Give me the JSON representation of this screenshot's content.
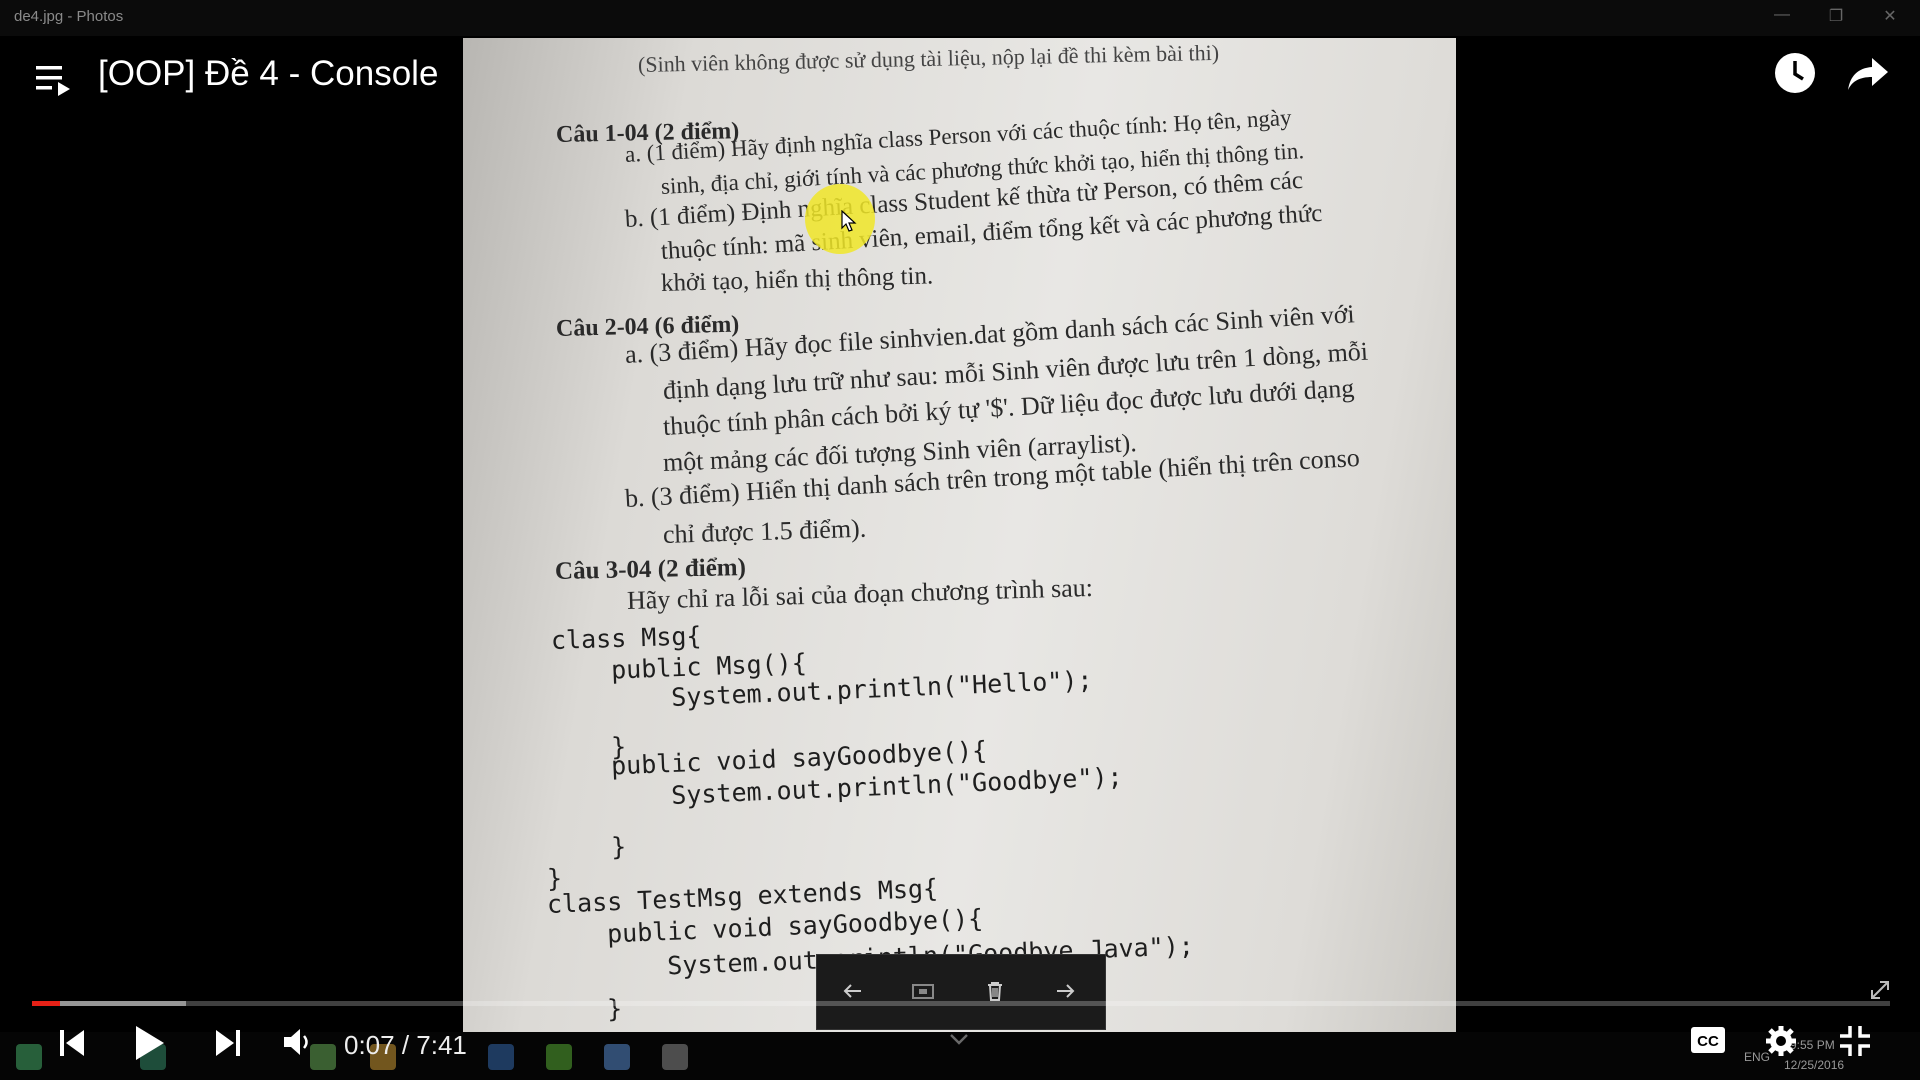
{
  "window": {
    "title": "de4.jpg - Photos",
    "controls": [
      "—",
      "❐",
      "✕"
    ]
  },
  "video": {
    "title": "[OOP] Đề 4 - Console",
    "current_time": "0:07",
    "duration": "7:41",
    "time_display": "0:07 / 7:41",
    "progress_fraction": 0.015,
    "buffered_fraction": 0.083,
    "accent_color": "#e62117"
  },
  "document": {
    "header_note": "(Sinh viên không được sử dụng tài liệu, nộp lại đề thi kèm bài thi)",
    "q1_title": "Câu 1-04 (2 điểm)",
    "q1a_line1": "a. (1 điểm) Hãy định nghĩa class Person với các thuộc tính: Họ tên, ngày",
    "q1a_line2": "sinh, địa chỉ, giới tính và các phương thức khởi tạo, hiển thị thông tin.",
    "q1b_line1": "b. (1 điểm) Định nghĩa class Student kế thừa từ Person, có thêm các",
    "q1b_line2": "thuộc tính: mã sinh viên, email, điểm tổng kết và các phương thức",
    "q1b_line3": "khởi tạo, hiển thị thông tin.",
    "q2_title": "Câu 2-04 (6 điểm)",
    "q2a_line1": "a. (3 điểm) Hãy đọc file sinhvien.dat gồm danh sách các Sinh viên với",
    "q2a_line2": "định dạng lưu trữ như sau: mỗi Sinh viên được lưu trên 1 dòng, mỗi",
    "q2a_line3": "thuộc tính phân cách bởi ký tự '$'. Dữ liệu đọc được lưu dưới dạng",
    "q2a_line4": "một mảng các đối tượng Sinh viên (arraylist).",
    "q2b_line1": "b. (3 điểm) Hiển thị danh sách trên trong một table (hiển thị trên conso",
    "q2b_line2": "chỉ được 1.5 điểm).",
    "q3_title": "Câu 3-04 (2 điểm)",
    "q3_intro": "Hãy chỉ ra lỗi sai của đoạn chương trình sau:",
    "code": [
      "class Msg{",
      "    public Msg(){",
      "        System.out.println(\"Hello\");",
      "    }",
      "    public void sayGoodbye(){",
      "        System.out.println(\"Goodbye\");",
      "    }",
      "}",
      "class TestMsg extends Msg{",
      "    public void sayGoodbye(){",
      "        System.out.println(\"Goodbye Java\");",
      "    }"
    ]
  },
  "photo_nav": {
    "prev_icon": "arrow-left-icon",
    "slideshow_icon": "slideshow-icon",
    "delete_icon": "trash-icon",
    "next_icon": "arrow-right-icon"
  },
  "tray": {
    "lang": "ENG",
    "clock_time": "9:55 PM",
    "clock_date": "12/25/2016"
  },
  "icons": {
    "playlist": "playlist-icon",
    "watch_later": "clock-icon",
    "share": "share-icon",
    "prev": "skip-previous-icon",
    "play": "play-icon",
    "next": "skip-next-icon",
    "volume": "volume-icon",
    "cc": "cc-icon",
    "settings": "gear-icon",
    "exit_fullscreen": "exit-fullscreen-icon"
  }
}
